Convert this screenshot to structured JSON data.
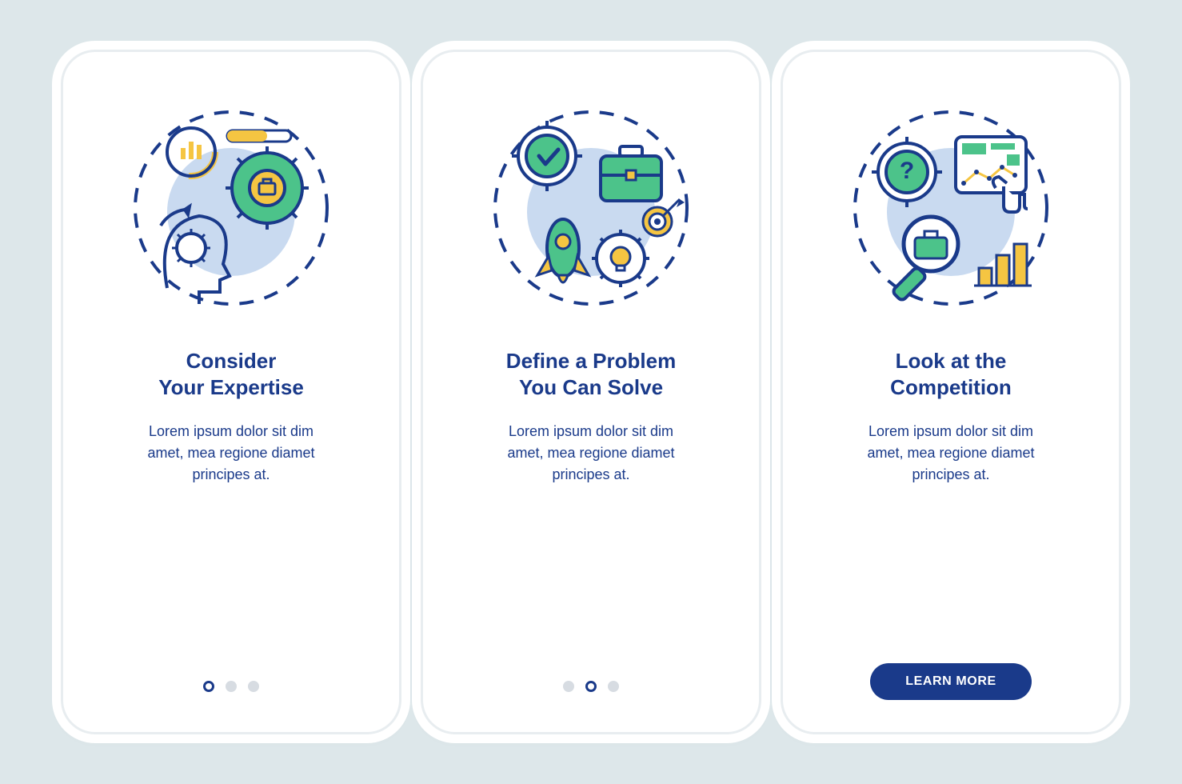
{
  "colors": {
    "background": "#dde7ea",
    "card": "#ffffff",
    "primary": "#1a3a8a",
    "accent_green": "#4cc38a",
    "accent_yellow": "#f5c542",
    "muted_blue": "#c9daf0",
    "dot_inactive": "#d7dce2"
  },
  "screens": [
    {
      "title": "Consider\nYour Expertise",
      "body": "Lorem ipsum dolor sit dim\namet, mea regione diamet\nprincipes at.",
      "icon_name": "expertise-icon",
      "pagination": {
        "total": 3,
        "active": 0
      }
    },
    {
      "title": "Define a Problem\nYou Can Solve",
      "body": "Lorem ipsum dolor sit dim\namet, mea regione diamet\nprincipes at.",
      "icon_name": "problem-solve-icon",
      "pagination": {
        "total": 3,
        "active": 1
      }
    },
    {
      "title": "Look at the\nCompetition",
      "body": "Lorem ipsum dolor sit dim\namet, mea regione diamet\nprincipes at.",
      "icon_name": "competition-icon",
      "cta_label": "LEARN MORE"
    }
  ]
}
